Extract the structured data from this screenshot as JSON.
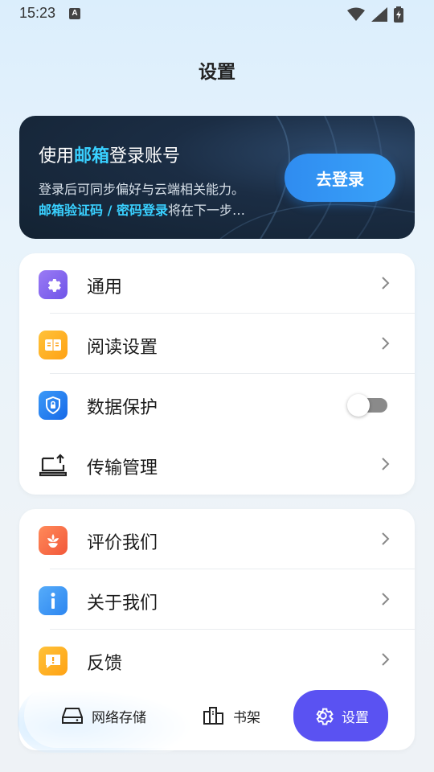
{
  "status_bar": {
    "time": "15:23",
    "ime_badge": "A"
  },
  "page": {
    "title": "设置"
  },
  "login_card": {
    "title_prefix": "使用",
    "title_highlight": "邮箱",
    "title_suffix": "登录账号",
    "description": "登录后可同步偏好与云端相关能力。",
    "note_highlight": "邮箱验证码 / 密码登录",
    "note_suffix": "将在下一步…",
    "button_label": "去登录",
    "highlight_color": "#39d0ff"
  },
  "group1": {
    "items": [
      {
        "label": "通用",
        "icon": "gear-icon",
        "control": "chevron"
      },
      {
        "label": "阅读设置",
        "icon": "book-icon",
        "control": "chevron"
      },
      {
        "label": "数据保护",
        "icon": "shield-lock-icon",
        "control": "toggle",
        "toggle_on": false
      },
      {
        "label": "传输管理",
        "icon": "laptop-upload-icon",
        "control": "chevron"
      }
    ]
  },
  "group2": {
    "items": [
      {
        "label": "评价我们",
        "icon": "flower-icon",
        "control": "chevron"
      },
      {
        "label": "关于我们",
        "icon": "info-icon",
        "control": "chevron"
      },
      {
        "label": "反馈",
        "icon": "feedback-icon",
        "control": "chevron"
      }
    ]
  },
  "bottom_nav": {
    "items": [
      {
        "label": "网络存储",
        "icon": "drive-icon",
        "active": false
      },
      {
        "label": "书架",
        "icon": "bookshelf-icon",
        "active": false
      },
      {
        "label": "设置",
        "icon": "gear-icon",
        "active": true
      }
    ],
    "active_color": "#5a52f2"
  }
}
